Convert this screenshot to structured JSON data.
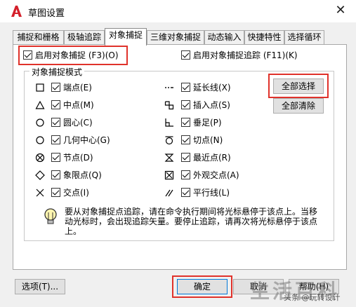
{
  "window": {
    "title": "草图设置",
    "close_glyph": "✕",
    "app_icon": "autocad-a-icon"
  },
  "tabs": [
    {
      "label": "捕捉和栅格",
      "active": false
    },
    {
      "label": "极轴追踪",
      "active": false
    },
    {
      "label": "对象捕捉",
      "active": true
    },
    {
      "label": "三维对象捕捉",
      "active": false
    },
    {
      "label": "动态输入",
      "active": false
    },
    {
      "label": "快捷特性",
      "active": false
    },
    {
      "label": "选择循环",
      "active": false
    }
  ],
  "osnap_on": {
    "label": "启用对象捕捉 (F3)(O)",
    "checked": true
  },
  "otrack_on": {
    "label": "启用对象捕捉追踪 (F11)(K)",
    "checked": true
  },
  "group_title": "对象捕捉模式",
  "modes_left": [
    {
      "label": "端点(E)",
      "icon": "endpoint-square-icon",
      "checked": true
    },
    {
      "label": "中点(M)",
      "icon": "midpoint-triangle-icon",
      "checked": true
    },
    {
      "label": "圆心(C)",
      "icon": "center-circle-icon",
      "checked": true
    },
    {
      "label": "几何中心(G)",
      "icon": "geometric-center-icon",
      "checked": true
    },
    {
      "label": "节点(D)",
      "icon": "node-icon",
      "checked": true
    },
    {
      "label": "象限点(Q)",
      "icon": "quadrant-diamond-icon",
      "checked": true
    },
    {
      "label": "交点(I)",
      "icon": "intersection-x-icon",
      "checked": true
    }
  ],
  "modes_right": [
    {
      "label": "延长线(X)",
      "icon": "extension-icon",
      "checked": true
    },
    {
      "label": "插入点(S)",
      "icon": "insertion-icon",
      "checked": true
    },
    {
      "label": "垂足(P)",
      "icon": "perpendicular-icon",
      "checked": true
    },
    {
      "label": "切点(N)",
      "icon": "tangent-icon",
      "checked": true
    },
    {
      "label": "最近点(R)",
      "icon": "nearest-icon",
      "checked": true
    },
    {
      "label": "外观交点(A)",
      "icon": "apparent-intersection-icon",
      "checked": true
    },
    {
      "label": "平行线(L)",
      "icon": "parallel-icon",
      "checked": true
    }
  ],
  "buttons": {
    "select_all": "全部选择",
    "clear_all": "全部清除",
    "options": "选项(T)...",
    "ok": "确定",
    "cancel": "取消",
    "help": "帮助(H)"
  },
  "tip": {
    "icon": "lightbulb-icon",
    "text": "要从对象捕捉点追踪，请在命令执行期间将光标悬停于该点上。当移动光标时，会出现追踪矢量。要停止追踪，请再次将光标悬停于该点上。"
  },
  "watermark": {
    "main": "生活百科",
    "sub": "头条 @玩转设计"
  },
  "colors": {
    "highlight_red": "#e0322b",
    "accent_blue": "#0078d7",
    "icon_red": "#d4202b"
  }
}
